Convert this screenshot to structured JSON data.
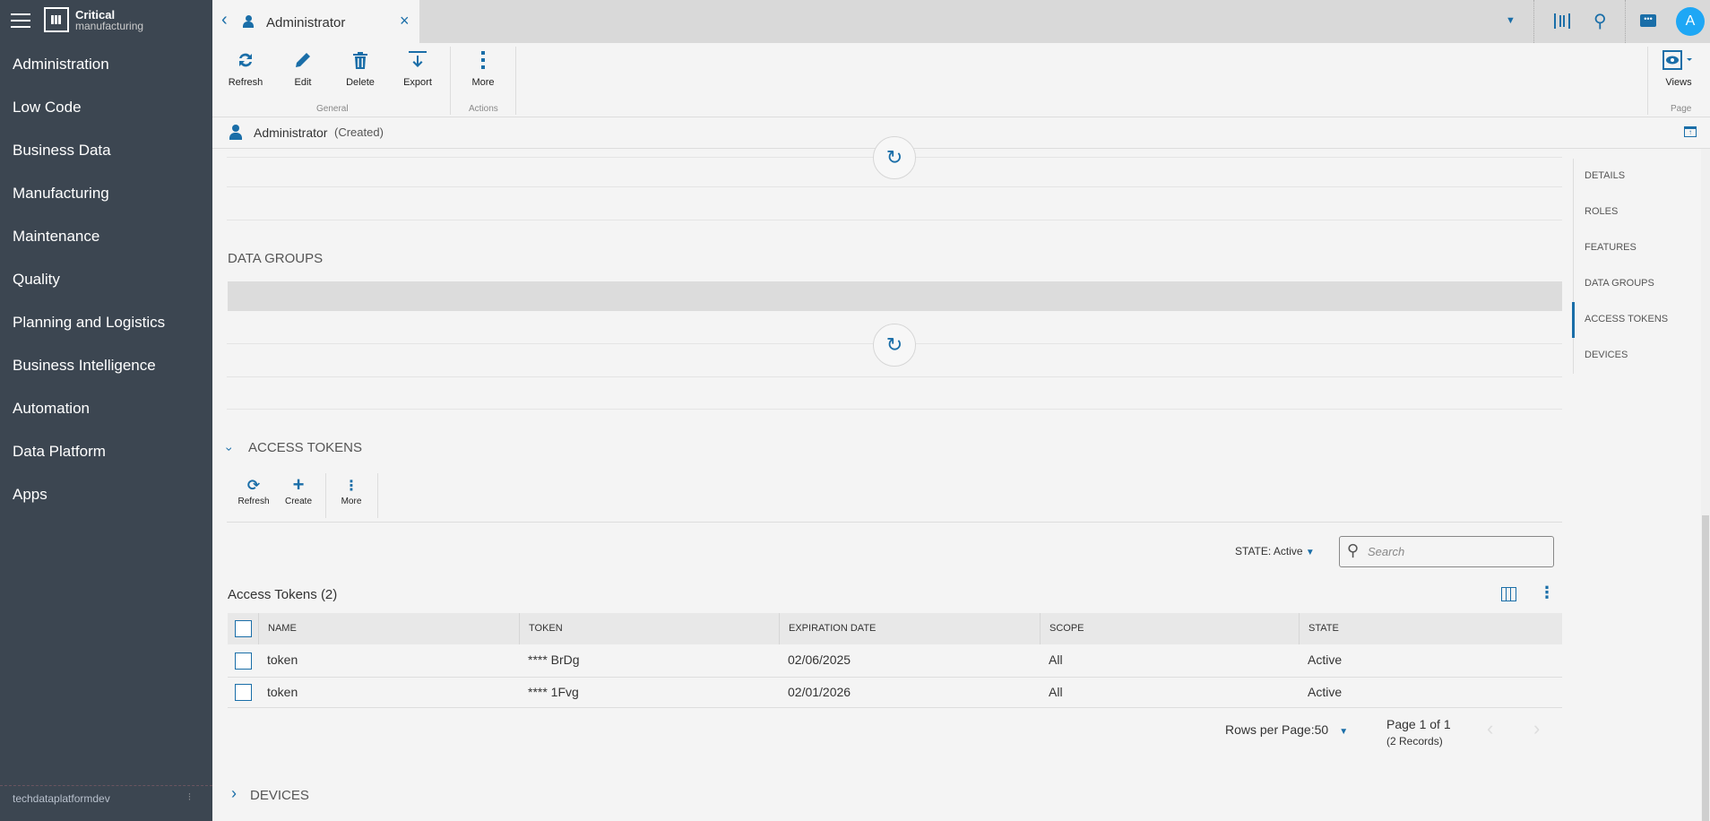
{
  "brand": {
    "name_bold": "Critical",
    "name_light": "manufacturing"
  },
  "sidebar": {
    "items": [
      "Administration",
      "Low Code",
      "Business Data",
      "Manufacturing",
      "Maintenance",
      "Quality",
      "Planning and Logistics",
      "Business Intelligence",
      "Automation",
      "Data Platform",
      "Apps"
    ],
    "footer": "techdataplatformdev"
  },
  "tab": {
    "title": "Administrator"
  },
  "user": {
    "avatar": "A"
  },
  "ribbon": {
    "refresh": "Refresh",
    "edit": "Edit",
    "delete": "Delete",
    "export": "Export",
    "more": "More",
    "views": "Views",
    "group_general": "General",
    "group_actions": "Actions",
    "group_page": "Page"
  },
  "entity": {
    "name": "Administrator",
    "status": "(Created)"
  },
  "nav": [
    "DETAILS",
    "ROLES",
    "FEATURES",
    "DATA GROUPS",
    "ACCESS TOKENS",
    "DEVICES"
  ],
  "sections": {
    "data_groups": "DATA GROUPS",
    "access_tokens": "ACCESS TOKENS",
    "devices": "DEVICES"
  },
  "tokens_toolbar": {
    "refresh": "Refresh",
    "create": "Create",
    "more": "More"
  },
  "filter": {
    "state": "STATE: Active",
    "search_placeholder": "Search"
  },
  "grid": {
    "title": "Access Tokens (2)",
    "columns": [
      "NAME",
      "TOKEN",
      "EXPIRATION DATE",
      "SCOPE",
      "STATE"
    ],
    "rows": [
      [
        "token",
        "**** BrDg",
        "02/06/2025",
        "All",
        "Active"
      ],
      [
        "token",
        "**** 1Fvg",
        "02/01/2026",
        "All",
        "Active"
      ]
    ]
  },
  "pager": {
    "rows_per_page": "Rows per Page:50",
    "page": "Page 1 of 1",
    "records": "(2 Records)"
  },
  "colors": {
    "accent": "#1a6ea8",
    "sidebar": "#3c4651",
    "avatar": "#1ea7f5"
  }
}
